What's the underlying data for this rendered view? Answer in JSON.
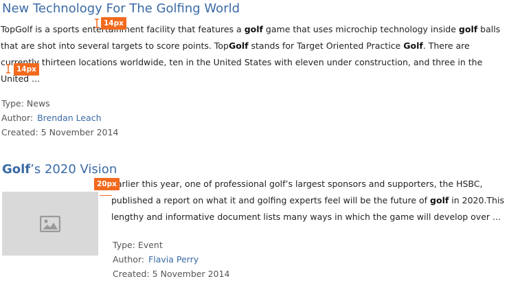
{
  "results": [
    {
      "title_parts": [
        "New Technology For The Golfing World"
      ],
      "description": [
        {
          "t": "TopGolf is a sports entertainment facility that features a "
        },
        {
          "t": "golf",
          "b": true
        },
        {
          "t": " game that uses microchip technology inside "
        },
        {
          "t": "golf",
          "b": true
        },
        {
          "t": " balls that are shot into several targets to score points. Top"
        },
        {
          "t": "Golf",
          "b": true
        },
        {
          "t": " stands for Target Oriented Practice "
        },
        {
          "t": "Golf",
          "b": true
        },
        {
          "t": ". There are currently thirteen locations worldwide, ten in the United States with eleven under construction, and three in the United ..."
        }
      ],
      "type_label": "Type:",
      "type_value": "News",
      "author_label": "Author:",
      "author_name": "Brendan Leach",
      "created_label": "Created:",
      "created_date": "5 November 2014"
    },
    {
      "title_bold": "Golf",
      "title_rest": "’s 2020 Vision",
      "description": [
        {
          "t": "Earlier this year, one of professional golf’s largest sponsors and supporters, the HSBC, published a report on what it and golfing experts feel will be the future of "
        },
        {
          "t": "golf",
          "b": true
        },
        {
          "t": " in 2020.This lengthy and informative document lists many ways in which the game will develop over ..."
        }
      ],
      "type_label": "Type:",
      "type_value": "Event",
      "author_label": "Author:",
      "author_name": "Flavia Perry",
      "created_label": "Created:",
      "created_date": "5 November 2014",
      "thumbnail_icon": "image-placeholder-icon"
    }
  ],
  "annotations": {
    "spacing_1": "14px",
    "spacing_2": "14px",
    "spacing_3": "20px"
  },
  "colors": {
    "link": "#3a6aa5",
    "annotation": "#f26a1e",
    "thumbnail_bg": "#d9d9d9"
  }
}
